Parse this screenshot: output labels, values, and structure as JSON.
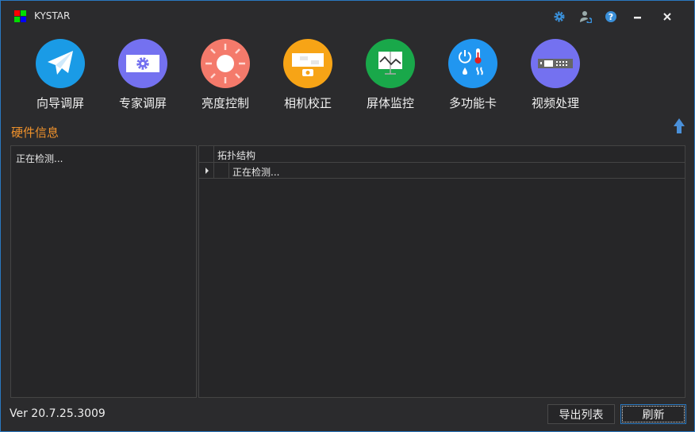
{
  "app": {
    "title": "KYSTAR"
  },
  "titlebar": {
    "icons": [
      "settings-icon",
      "user-switch-icon",
      "help-icon",
      "minimize-icon",
      "close-icon"
    ]
  },
  "toolbar": [
    {
      "label": "向导调屏",
      "icon": "paper-plane-icon",
      "color": "#1a9be6"
    },
    {
      "label": "专家调屏",
      "icon": "screen-gear-icon",
      "color": "#7471f0"
    },
    {
      "label": "亮度控制",
      "icon": "sun-icon",
      "color": "#f47a6b"
    },
    {
      "label": "相机校正",
      "icon": "camera-screen-icon",
      "color": "#f7a416"
    },
    {
      "label": "屏体监控",
      "icon": "monitor-chart-icon",
      "color": "#19a84a"
    },
    {
      "label": "多功能卡",
      "icon": "multifunction-icon",
      "color": "#2196f0"
    },
    {
      "label": "视频处理",
      "icon": "video-processor-icon",
      "color": "#7471f0"
    }
  ],
  "section": {
    "title": "硬件信息"
  },
  "left_panel": {
    "status": "正在检测..."
  },
  "topology": {
    "header": "拓扑结构",
    "rows": [
      {
        "text": "正在检测..."
      }
    ]
  },
  "footer": {
    "version": "Ver 20.7.25.3009",
    "export_label": "导出列表",
    "refresh_label": "刷新"
  },
  "colors": {
    "accent": "#2a78c0",
    "section": "#f0922b"
  }
}
